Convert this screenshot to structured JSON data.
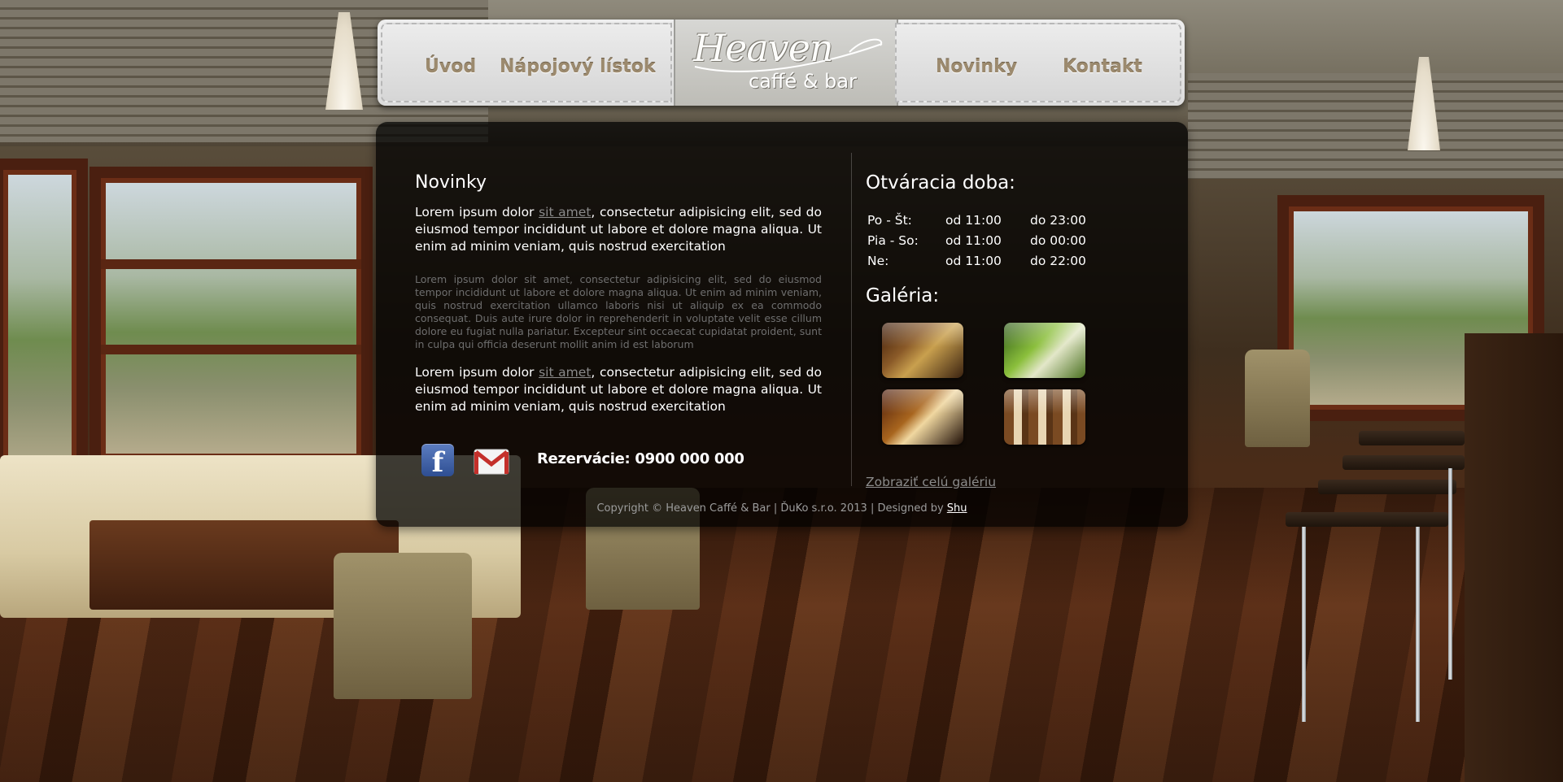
{
  "nav": {
    "items_left": [
      "Úvod",
      "Nápojový lístok"
    ],
    "items_right": [
      "Novinky",
      "Kontakt"
    ],
    "logo_script": "Heaven",
    "logo_sub": "caffé & bar"
  },
  "news": {
    "title": "Novinky",
    "p1_before": "Lorem ipsum dolor ",
    "p1_link": "sit amet",
    "p1_after": ", consectetur adipisicing elit, sed do eiusmod tempor incididunt ut labore et dolore magna aliqua. Ut enim ad minim veniam, quis nostrud exercitation",
    "p2": "Lorem ipsum dolor sit amet, consectetur adipisicing elit, sed do eiusmod tempor incididunt ut labore et dolore magna aliqua. Ut enim ad minim veniam, quis nostrud exercitation ullamco laboris nisi ut aliquip ex ea commodo consequat. Duis aute irure dolor in reprehenderit in voluptate velit esse cillum dolore eu fugiat nulla pariatur. Excepteur sint occaecat cupidatat proident, sunt in culpa qui officia deserunt mollit anim id est laborum",
    "p3_before": "Lorem ipsum dolor ",
    "p3_link": "sit amet",
    "p3_after": ", consectetur adipisicing elit, sed do eiusmod tempor incididunt ut labore et dolore magna aliqua. Ut enim ad minim veniam, quis nostrud exercitation"
  },
  "contact": {
    "facebook_icon": "facebook-icon",
    "mail_icon": "gmail-icon",
    "reservation": "Rezervácie: 0900 000 000"
  },
  "hours": {
    "title": "Otváracia doba:",
    "rows": [
      {
        "day": "Po - Št:",
        "from": "od 11:00",
        "to": "do 23:00"
      },
      {
        "day": "Pia - So:",
        "from": "od 11:00",
        "to": "do 00:00"
      },
      {
        "day": "Ne:",
        "from": "od 11:00",
        "to": "do 22:00"
      }
    ]
  },
  "gallery": {
    "title": "Galéria:",
    "link": "Zobraziť celú galériu"
  },
  "footer": {
    "copyright": "Copyright © Heaven Caffé & Bar | ĎuKo s.r.o. 2013 | Designed by ",
    "designer": "Shu"
  },
  "colors": {
    "nav_text": "#9c8a6e",
    "panel_bg": "rgba(0,0,0,0.74)",
    "link_gray": "#8a8a8a"
  }
}
